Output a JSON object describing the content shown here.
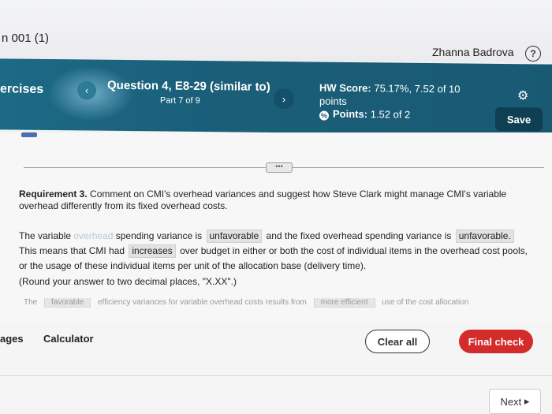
{
  "course": {
    "title": "n 001 (1)"
  },
  "user": {
    "name": "Zhanna Badrova",
    "help_icon": "question-circle-icon"
  },
  "header": {
    "nav_label": "ercises",
    "question_title": "Question 4, E8-29 (similar to)",
    "part": "Part 7 of 9",
    "hw_score_label": "HW Score:",
    "hw_score_value": "75.17%, 7.52 of 10",
    "hw_score_unit": "points",
    "points_label": "Points:",
    "points_value": "1.52 of 2",
    "save_label": "Save",
    "accent_color": "#1a5e78"
  },
  "content": {
    "requirement_label": "Requirement 3.",
    "requirement_text": "Comment on CMI's overhead variances and suggest how Steve Clark might manage CMI's variable overhead differently from its fixed overhead costs.",
    "para": {
      "t1": "The variable ",
      "t1_ghost": "overhead",
      "t1b": " spending variance is ",
      "blank1": "unfavorable",
      "t2": " and the fixed overhead spending variance is ",
      "blank2": "unfavorable.",
      "t3": " This means that CMI had ",
      "blank3": "increases",
      "t4": " over budget in either or both the cost of individual items in the overhead cost pools, or the usage of these individual items per unit of the allocation base (delivery time)."
    },
    "round_note": "(Round your answer to two decimal places, \"X.XX\".)",
    "cutoff": {
      "w1": "The",
      "b1": "favorable",
      "w2": "efficiency variances for variable overhead costs results from",
      "b2": "more efficient",
      "w3": "use of the cost allocation"
    }
  },
  "footer": {
    "pages_label": "ages",
    "calculator_label": "Calculator",
    "clear_label": "Clear all",
    "final_label": "Final check",
    "next_label": "Next",
    "final_color": "#d42b2b"
  }
}
